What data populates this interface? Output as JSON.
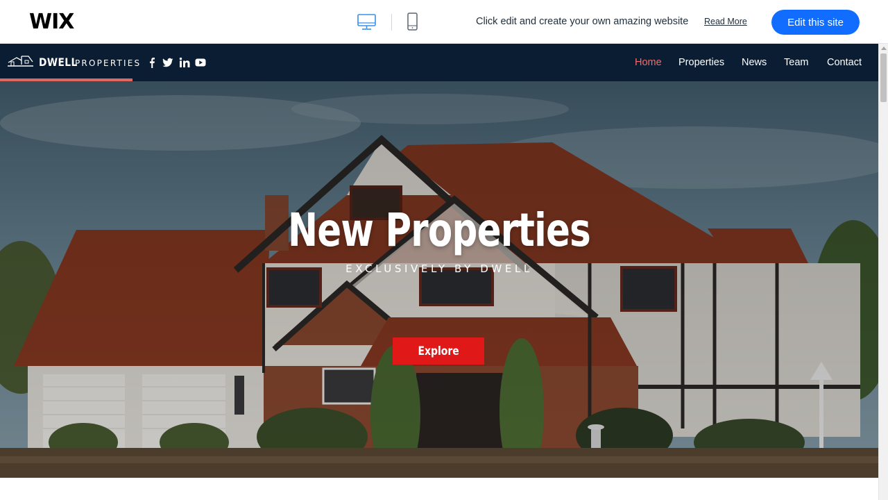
{
  "wix_bar": {
    "logo": "WIX",
    "promo_text": "Click edit and create your own amazing website",
    "read_more": "Read More",
    "edit_button": "Edit this site",
    "icons": [
      "desktop-icon",
      "mobile-icon"
    ]
  },
  "site": {
    "brand": {
      "name": "DWELL",
      "sub": "PROPERTIES"
    },
    "social": [
      "facebook-icon",
      "twitter-icon",
      "linkedin-icon",
      "youtube-icon"
    ],
    "nav": [
      {
        "label": "Home",
        "active": true
      },
      {
        "label": "Properties",
        "active": false
      },
      {
        "label": "News",
        "active": false
      },
      {
        "label": "Team",
        "active": false
      },
      {
        "label": "Contact",
        "active": false
      }
    ],
    "hero": {
      "title": "New Properties",
      "subtitle": "EXCLUSIVELY BY DWELL",
      "button": "Explore"
    }
  },
  "colors": {
    "wix_blue": "#116dff",
    "header_bg": "#0b1d33",
    "nav_active": "#f36b6b",
    "brand_underline": "#e06860",
    "explore_red": "#e01818"
  }
}
